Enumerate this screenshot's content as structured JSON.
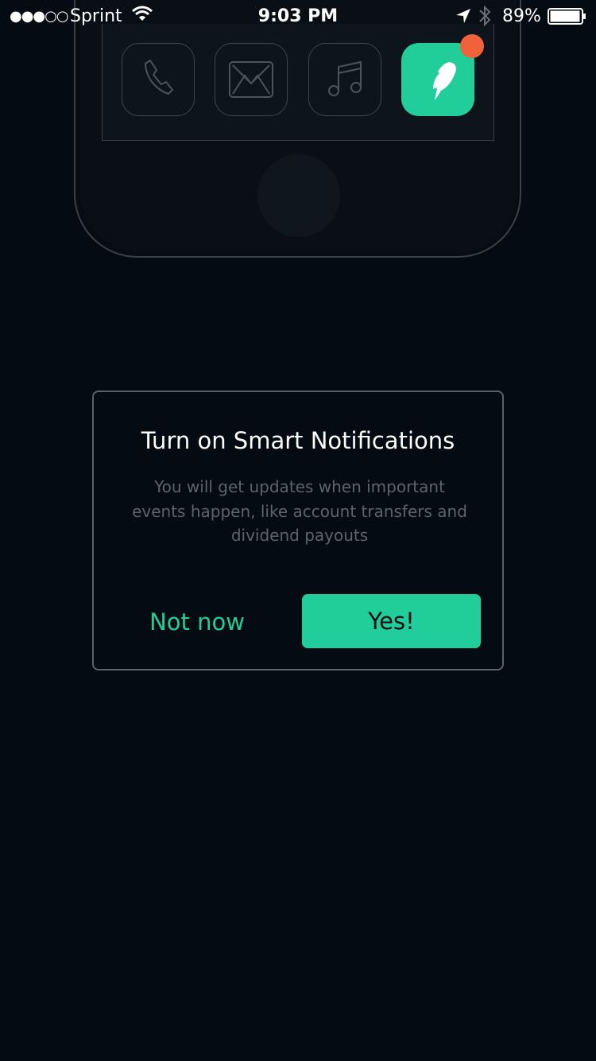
{
  "status_bar": {
    "carrier": "Sprint",
    "signal": "●●●○○",
    "time": "9:03 PM",
    "battery": "89%",
    "battery_level": 0.89
  },
  "illustration": {
    "icons": [
      "phone-icon",
      "mail-icon",
      "music-icon",
      "feather-icon"
    ],
    "badge_color": "#f0623a",
    "accent": "#21ce99"
  },
  "dialog": {
    "title": "Turn on Smart Notifications",
    "body": "You will get updates when important events happen, like account transfers and dividend payouts",
    "secondary_label": "Not now",
    "primary_label": "Yes!"
  }
}
